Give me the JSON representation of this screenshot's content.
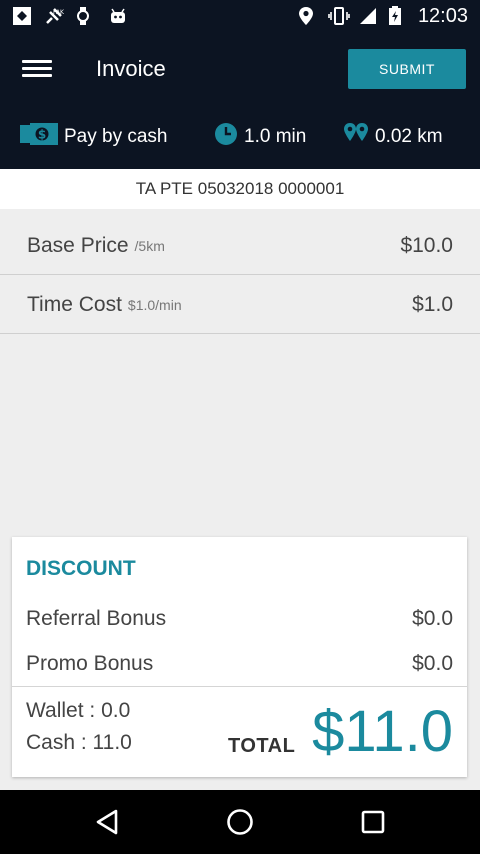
{
  "status_bar": {
    "time": "12:03",
    "icons": [
      "app-icon",
      "fake-gps-icon",
      "watch-icon",
      "android-icon",
      "location-icon",
      "vibrate-icon",
      "signal-icon",
      "battery-icon"
    ]
  },
  "header": {
    "title": "Invoice",
    "submit_label": "SUBMIT",
    "payment_method": "Pay by cash",
    "duration": "1.0 min",
    "distance": "0.02 km"
  },
  "invoice_number": "TA PTE 05032018 0000001",
  "line_items": [
    {
      "label": "Base Price",
      "sub": "/5km",
      "value": "$10.0"
    },
    {
      "label": "Time Cost",
      "sub": "$1.0/min",
      "value": "$1.0"
    }
  ],
  "discount": {
    "title": "DISCOUNT",
    "rows": [
      {
        "label": "Referral Bonus",
        "value": "$0.0"
      },
      {
        "label": "Promo Bonus",
        "value": "$0.0"
      }
    ]
  },
  "summary": {
    "wallet": "Wallet : 0.0",
    "cash": "Cash : 11.0",
    "total_label": "TOTAL",
    "total_value": "$11.0"
  },
  "colors": {
    "header_bg": "#0c1422",
    "accent": "#1b8a9e"
  }
}
